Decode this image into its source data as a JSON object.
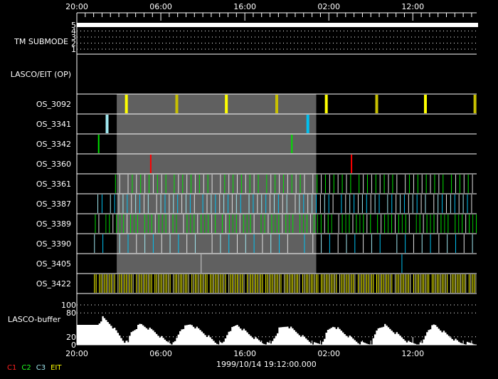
{
  "chart_data": {
    "type": "timeline",
    "time_span_hours": 47.6,
    "x_tick_labels": [
      "20:00",
      "06:00",
      "16:00",
      "02:00",
      "12:00"
    ],
    "x_tick_label_hours": [
      0,
      10,
      20,
      30,
      40
    ],
    "date_label": "1999/10/14 19:12:00.000",
    "shaded_interval_hours": [
      4.75,
      28.5
    ],
    "tm_submode": {
      "label": "TM SUBMODE",
      "levels": [
        "5",
        "4",
        "3",
        "2",
        "1"
      ],
      "value": 5
    },
    "lasco_eit_label": "LASCO/EIT (OP)",
    "rows": [
      {
        "name": "OS_3092",
        "events": [
          [
            5.9,
            "#ffff00"
          ],
          [
            11.9,
            "#c8c000"
          ],
          [
            17.8,
            "#ffff00"
          ],
          [
            23.8,
            "#c8c000"
          ],
          [
            29.7,
            "#ffff00"
          ],
          [
            35.7,
            "#c8c000"
          ],
          [
            41.5,
            "#ffff00"
          ],
          [
            47.4,
            "#c8c000"
          ]
        ],
        "width": 4
      },
      {
        "name": "OS_3341",
        "events": [
          [
            3.6,
            "#a0e8f0"
          ],
          [
            27.5,
            "#00c0f0"
          ]
        ],
        "width": 4
      },
      {
        "name": "OS_3342",
        "events": [
          [
            2.6,
            "#00e000"
          ],
          [
            25.6,
            "#00e000"
          ]
        ],
        "width": 2
      },
      {
        "name": "OS_3360",
        "events": [
          [
            8.8,
            "#ff0000"
          ],
          [
            32.7,
            "#ff0000"
          ]
        ],
        "width": 2
      },
      {
        "name": "OS_3361",
        "periodic": {
          "start": 4.6,
          "interval": 0.5,
          "colors": [
            "#00e000",
            "#e0e0e0"
          ]
        },
        "width": 1
      },
      {
        "name": "OS_3387",
        "periodic": {
          "start": 2.5,
          "interval": 0.5,
          "colors": [
            "#a0e8f0",
            "#00c0f0",
            "#e0e0e0"
          ]
        },
        "width": 1
      },
      {
        "name": "OS_3389",
        "periodic": {
          "start": 2.2,
          "interval": 0.42,
          "colors": [
            "#00e000",
            "#e0e0e0",
            "#00e000",
            "#00c000"
          ]
        },
        "width": 1
      },
      {
        "name": "OS_3390",
        "periodic": {
          "start": 2.1,
          "interval": 1.0,
          "colors": [
            "#a0e8f0",
            "#00c0f0",
            "#e0e0e0"
          ]
        },
        "width": 1
      },
      {
        "name": "OS_3405",
        "events": [
          [
            14.8,
            "#d0d0d0"
          ],
          [
            38.7,
            "#00c0f0"
          ]
        ],
        "width": 1
      },
      {
        "name": "OS_3422",
        "periodic": {
          "start": 2.1,
          "interval": 0.2,
          "colors": [
            "#ffff00",
            "#ffff00",
            "#e0e0a0"
          ]
        },
        "width": 1
      }
    ],
    "buffer": {
      "label": "LASCO-buffer",
      "y_ticks": [
        "100",
        "80",
        "20",
        "0"
      ],
      "y_tick_values": [
        100,
        80,
        20,
        0
      ],
      "ylim": [
        0,
        100
      ],
      "keypoints": [
        [
          0,
          50
        ],
        [
          2.4,
          50
        ],
        [
          3.0,
          68
        ],
        [
          4,
          50
        ],
        [
          5.5,
          10
        ],
        [
          6.0,
          4
        ],
        [
          6.3,
          30
        ],
        [
          7.5,
          52
        ],
        [
          9,
          35
        ],
        [
          10.5,
          10
        ],
        [
          11.5,
          2
        ],
        [
          12.3,
          40
        ],
        [
          13.5,
          52
        ],
        [
          15,
          30
        ],
        [
          16.5,
          5
        ],
        [
          17.3,
          2
        ],
        [
          18,
          35
        ],
        [
          19,
          50
        ],
        [
          20.5,
          25
        ],
        [
          22,
          5
        ],
        [
          23,
          2
        ],
        [
          24,
          40
        ],
        [
          25,
          48
        ],
        [
          26.5,
          25
        ],
        [
          28,
          3
        ],
        [
          29,
          2
        ],
        [
          29.8,
          35
        ],
        [
          30.5,
          48
        ],
        [
          32,
          25
        ],
        [
          33.5,
          5
        ],
        [
          35,
          2
        ],
        [
          35.7,
          40
        ],
        [
          36.5,
          50
        ],
        [
          38,
          28
        ],
        [
          39.5,
          5
        ],
        [
          41,
          2
        ],
        [
          41.7,
          38
        ],
        [
          42.5,
          50
        ],
        [
          44,
          25
        ],
        [
          45.5,
          5
        ],
        [
          47.6,
          2
        ]
      ]
    },
    "legend": [
      {
        "label": "C1",
        "color": "#ff2020"
      },
      {
        "label": "C2",
        "color": "#20ff20"
      },
      {
        "label": "C3",
        "color": "#a0e8f0"
      },
      {
        "label": "EIT",
        "color": "#ffff00"
      }
    ]
  }
}
